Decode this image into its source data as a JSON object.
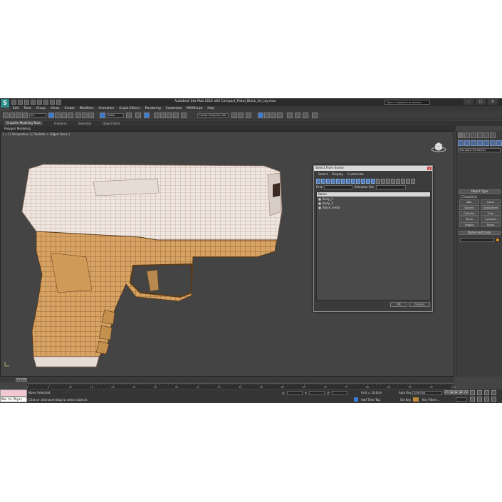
{
  "app": {
    "title": "Autodesk 3ds Max 2012 x64     Compact_Pistol_Black_3d_ray.max",
    "search_placeholder": "Type a keyword or phrase",
    "logo_letter": "S"
  },
  "menu": [
    "Edit",
    "Tools",
    "Group",
    "Views",
    "Create",
    "Modifiers",
    "Animation",
    "Graph Editors",
    "Rendering",
    "Customize",
    "MAXScript",
    "Help"
  ],
  "toolbar": {
    "filter_value": "All",
    "reference_coord": "View",
    "named_selection": "Create Selection Set"
  },
  "ribbon": {
    "tabs": [
      "Graphite Modeling Tools",
      "Freeform",
      "Selection",
      "Object Paint"
    ],
    "panel_label": "Polygon Modeling"
  },
  "viewport": {
    "label": "[ + ] [ Perspective ] [ Realistic + Edged Faces ]"
  },
  "command_panel": {
    "dropdown": "Standard Primitives",
    "object_type_title": "Object Type",
    "autogrid": "AutoGrid",
    "primitives": [
      "Box",
      "Cone",
      "Sphere",
      "GeoSphere",
      "Cylinder",
      "Tube",
      "Torus",
      "Pyramid",
      "Teapot",
      "Plane"
    ],
    "name_color_title": "Name and Color",
    "color": "#e08a2a"
  },
  "dialog": {
    "title": "Select From Scene",
    "close": "×",
    "menu": [
      "Select",
      "Display",
      "Customize"
    ],
    "find_label": "Find:",
    "selection_set_label": "Selection Set:",
    "column": "Name",
    "rows": [
      "Body_1",
      "Body_2",
      "Black_metal"
    ],
    "ok": "OK",
    "cancel": "Cancel"
  },
  "timeline": {
    "position": "0 / 100",
    "ticks": [
      "0",
      "5",
      "10",
      "15",
      "20",
      "25",
      "30",
      "35",
      "40",
      "45",
      "50",
      "55",
      "60",
      "65",
      "70",
      "75",
      "80",
      "85",
      "90",
      "95",
      "100"
    ]
  },
  "status": {
    "maxscript": "Max to Physc",
    "selection": "None Selected",
    "prompt": "Click or click-and-drag to select objects",
    "coord_x": "X:",
    "coord_y": "Y:",
    "coord_z": "Z:",
    "grid": "Grid = 10,0cm",
    "add_time_tag": "Add Time Tag",
    "auto_key": "Auto Key",
    "set_key": "Set Key",
    "selected": "Selected",
    "key_filters": "Key Filters...",
    "frame": "0"
  }
}
